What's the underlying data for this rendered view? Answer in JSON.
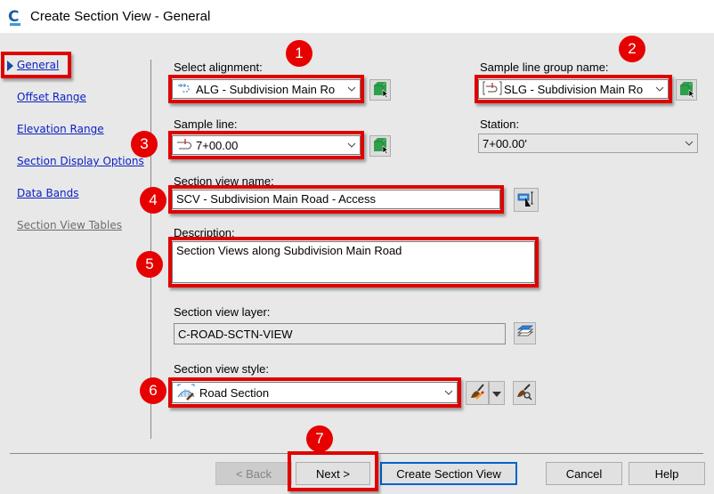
{
  "window": {
    "title": "Create Section View - General"
  },
  "nav": {
    "items": [
      {
        "label": "General",
        "active": true
      },
      {
        "label": "Offset Range"
      },
      {
        "label": "Elevation Range"
      },
      {
        "label": "Section Display Options"
      },
      {
        "label": "Data Bands"
      },
      {
        "label": "Section View Tables",
        "disabled": true
      }
    ]
  },
  "form": {
    "alignment": {
      "label": "Select alignment:",
      "value": "ALG - Subdivision Main Ro"
    },
    "sample_line_group": {
      "label": "Sample line group name:",
      "value": "SLG - Subdivision Main Ro"
    },
    "sample_line": {
      "label": "Sample line:",
      "value": "7+00.00"
    },
    "station": {
      "label": "Station:",
      "value": "7+00.00'"
    },
    "section_view_name": {
      "label": "Section view name:",
      "value": "SCV - Subdivision Main Road - Access"
    },
    "description": {
      "label": "Description:",
      "value": "Section Views along Subdivision Main Road"
    },
    "section_view_layer": {
      "label": "Section view layer:",
      "value": "C-ROAD-SCTN-VIEW"
    },
    "section_view_style": {
      "label": "Section view style:",
      "value": "Road Section"
    }
  },
  "buttons": {
    "back": "< Back",
    "next": "Next >",
    "create": "Create Section View",
    "cancel": "Cancel",
    "help": "Help"
  },
  "callouts": [
    "1",
    "2",
    "3",
    "4",
    "5",
    "6",
    "7"
  ],
  "colors": {
    "highlight": "#e00000",
    "link": "#0a22c4",
    "default_button_border": "#0063c9"
  }
}
